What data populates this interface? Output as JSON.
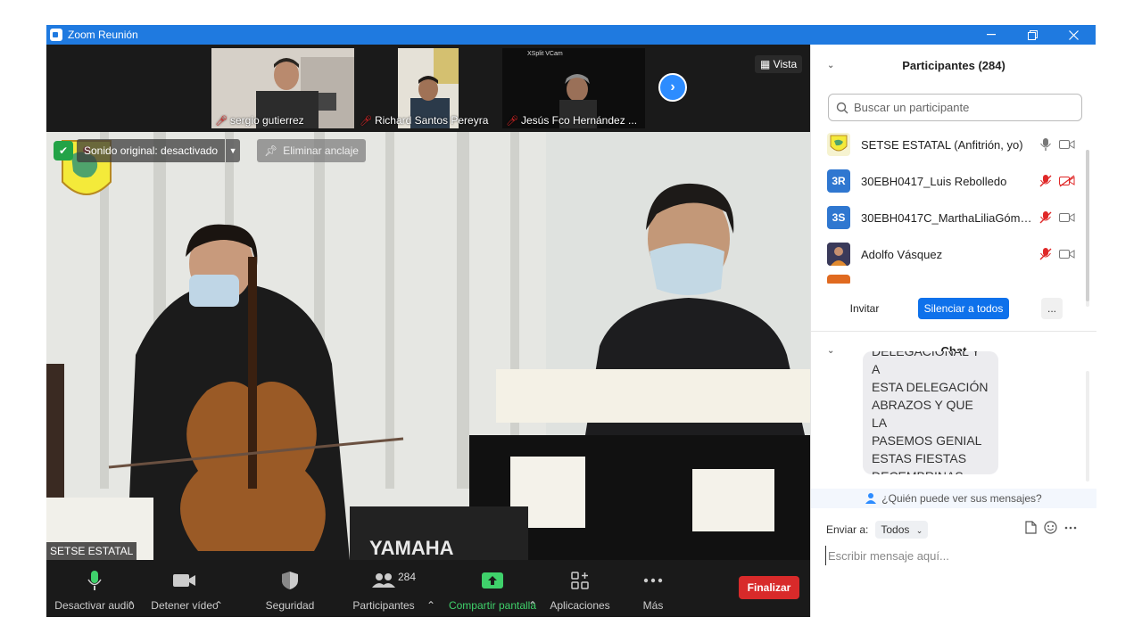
{
  "window": {
    "title": "Zoom Reunión",
    "controls": [
      "minimize",
      "restore",
      "close"
    ]
  },
  "thumbnails": [
    {
      "name": "sergio gutierrez",
      "muted": true
    },
    {
      "name": "Richard Santos Pereyra",
      "muted": true
    },
    {
      "name": "Jesús Fco Hernández ...",
      "muted": true,
      "overlay_label": "XSplit VCam"
    }
  ],
  "view_button": "Vista",
  "main_video": {
    "original_sound": "Sonido original: desactivado",
    "unpin": "Eliminar anclaje",
    "speaker": "SETSE ESTATAL"
  },
  "toolbar": {
    "mute": "Desactivar audio",
    "video": "Detener vídeo",
    "security": "Seguridad",
    "participants": "Participantes",
    "participants_count": "284",
    "share": "Compartir pantalla",
    "apps": "Aplicaciones",
    "more": "Más",
    "end": "Finalizar"
  },
  "participants_panel": {
    "title": "Participantes (284)",
    "search_placeholder": "Buscar un participante",
    "list": [
      {
        "initials": "",
        "name": "SETSE ESTATAL (Anfitrión, yo)",
        "avatar_color": "#e8e8e8",
        "mic": "on",
        "cam": "on"
      },
      {
        "initials": "3R",
        "name": "30EBH0417_Luis Rebolledo",
        "avatar_color": "#2f77d0",
        "mic": "muted",
        "cam": "off"
      },
      {
        "initials": "3S",
        "name": "30EBH0417C_MarthaLiliaGómez...",
        "avatar_color": "#2f77d0",
        "mic": "muted",
        "cam": "on"
      },
      {
        "initials": "",
        "name": "Adolfo Vásquez",
        "avatar_color": "#4a4a6a",
        "mic": "muted",
        "cam": "on"
      }
    ],
    "invite": "Invitar",
    "mute_all": "Silenciar a todos",
    "more": "..."
  },
  "chat": {
    "title": "Chat",
    "message_lines": [
      "DELEGACIONAL Y A",
      "ESTA DELEGACIÓN",
      "ABRAZOS Y QUE LA",
      "PASEMOS GENIAL",
      "ESTAS FIESTAS",
      "DECEMBRINAS"
    ],
    "who_can_see": "¿Quién puede ver sus mensajes?",
    "send_to_label": "Enviar a:",
    "send_to_value": "Todos",
    "input_placeholder": "Escribir mensaje aquí..."
  },
  "colors": {
    "titlebar": "#1f7ae0",
    "accent": "#2d8cff",
    "end": "#d82a2a",
    "share": "#3fd16b",
    "muted": "#e02828"
  }
}
